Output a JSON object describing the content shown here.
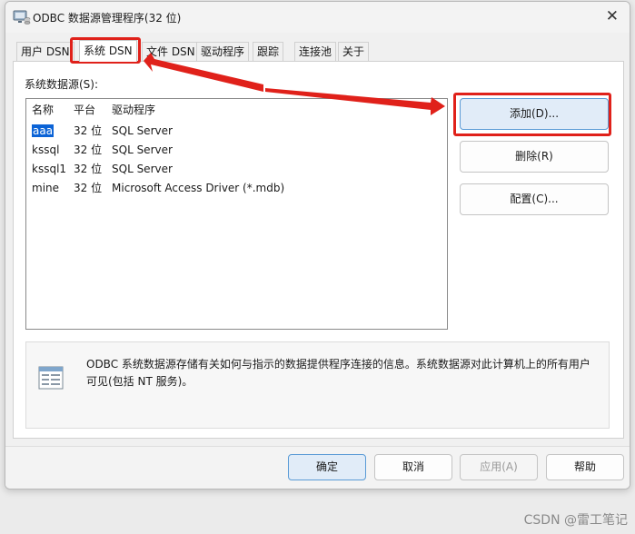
{
  "window": {
    "title": "ODBC 数据源管理程序(32 位)",
    "close_glyph": "✕"
  },
  "tabs": [
    {
      "label": "用户 DSN"
    },
    {
      "label": "系统 DSN"
    },
    {
      "label": "文件 DSN"
    },
    {
      "label": "驱动程序"
    },
    {
      "label": "跟踪"
    },
    {
      "label": "连接池"
    },
    {
      "label": "关于"
    }
  ],
  "active_tab": "系统 DSN",
  "list": {
    "label": "系统数据源(S):",
    "columns": [
      "名称",
      "平台",
      "驱动程序"
    ],
    "rows": [
      {
        "name": "aaa",
        "platform": "32 位",
        "driver": "SQL Server",
        "selected": true
      },
      {
        "name": "kssql",
        "platform": "32 位",
        "driver": "SQL Server"
      },
      {
        "name": "kssql1",
        "platform": "32 位",
        "driver": "SQL Server"
      },
      {
        "name": "mine",
        "platform": "32 位",
        "driver": "Microsoft Access Driver (*.mdb)"
      }
    ]
  },
  "side_buttons": {
    "add": "添加(D)...",
    "remove": "删除(R)",
    "configure": "配置(C)..."
  },
  "info": {
    "text": "ODBC 系统数据源存储有关如何与指示的数据提供程序连接的信息。系统数据源对此计算机上的所有用户可见(包括 NT 服务)。"
  },
  "footer": {
    "ok": "确定",
    "cancel": "取消",
    "apply": "应用(A)",
    "help": "帮助"
  },
  "watermark": "CSDN @雷工笔记",
  "colors": {
    "highlight_red": "#e0211a",
    "selection_blue": "#0b63d6"
  }
}
